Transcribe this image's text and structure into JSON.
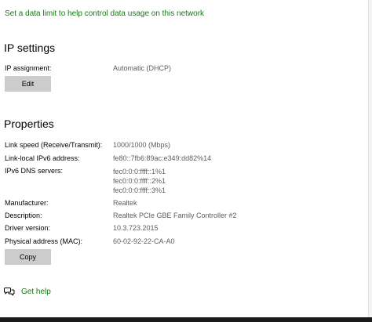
{
  "data_limit_link": "Set a data limit to help control data usage on this network",
  "ip_settings": {
    "heading": "IP settings",
    "assignment_label": "IP assignment:",
    "assignment_value": "Automatic (DHCP)",
    "edit_label": "Edit"
  },
  "properties": {
    "heading": "Properties",
    "link_speed_label": "Link speed (Receive/Transmit):",
    "link_speed_value": "1000/1000 (Mbps)",
    "ipv6_label": "Link-local IPv6 address:",
    "ipv6_value": "fe80::7fb6:89ac:e349:dd82%14",
    "dns_label": "IPv6 DNS servers:",
    "dns_values": [
      "fec0:0:0:ffff::1%1",
      "fec0:0:0:ffff::2%1",
      "fec0:0:0:ffff::3%1"
    ],
    "manufacturer_label": "Manufacturer:",
    "manufacturer_value": "Realtek",
    "description_label": "Description:",
    "description_value": "Realtek PCIe GBE Family Controller #2",
    "driver_label": "Driver version:",
    "driver_value": "10.3.723.2015",
    "mac_label": "Physical address (MAC):",
    "mac_value": "60-02-92-22-CA-A0",
    "copy_label": "Copy"
  },
  "help": {
    "label": "Get help",
    "icon": "chat-bubbles-icon"
  },
  "colors": {
    "link": "#107c10",
    "value_text": "#5d5d5d",
    "button_bg": "#cccccc"
  }
}
